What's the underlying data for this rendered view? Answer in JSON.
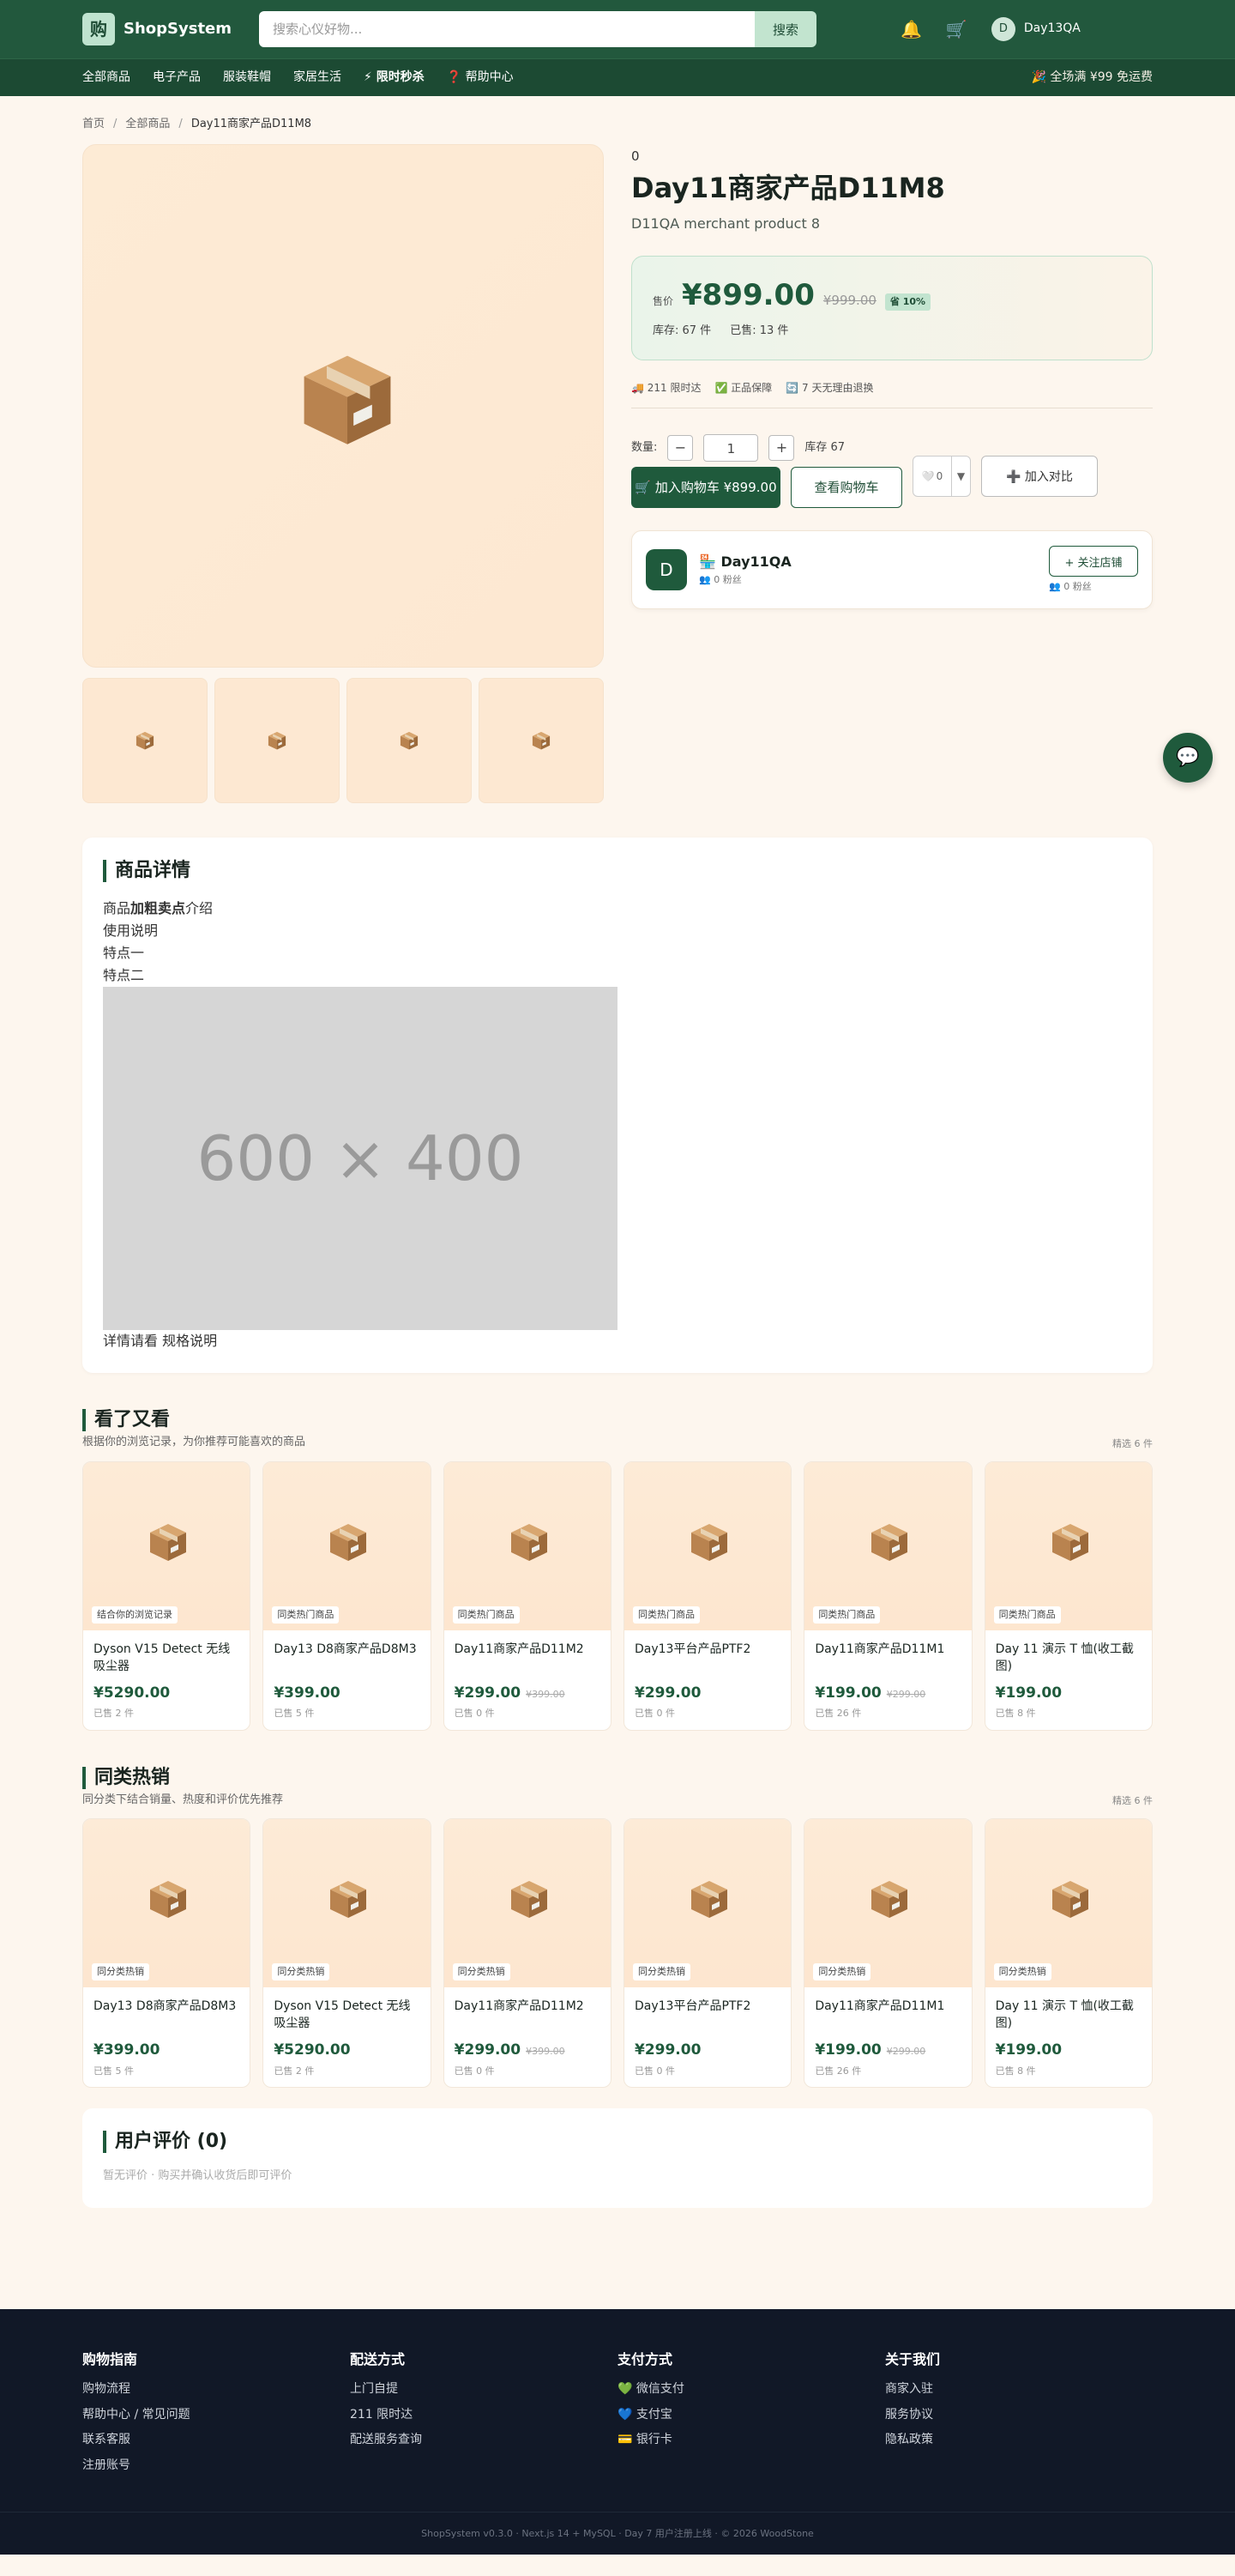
{
  "header": {
    "logo_char": "购",
    "logo_text": "ShopSystem",
    "search_placeholder": "搜索心仪好物...",
    "search_button": "搜索",
    "user_initial": "D",
    "user_name": "Day13QA"
  },
  "nav": {
    "items": [
      "全部商品",
      "电子产品",
      "服装鞋帽",
      "家居生活",
      "⚡ 限时秒杀",
      "❓ 帮助中心"
    ],
    "promo": "🎉 全场满 ¥99 免运费"
  },
  "breadcrumb": [
    "首页",
    "全部商品",
    "Day11商家产品D11M8"
  ],
  "product": {
    "keyword": "0",
    "title": "Day11商家产品D11M8",
    "subtitle": "D11QA merchant product 8",
    "price_label": "售价",
    "price": "¥899.00",
    "old_price": "¥999.00",
    "discount": "省 10%",
    "stock": "库存: 67 件",
    "sold": "已售: 13 件",
    "tags": [
      "🚚 211 限时达",
      "✅ 正品保障",
      "🔄 7 天无理由退换"
    ],
    "qty_label": "数量:",
    "qty_minus": "−",
    "qty_value": "1",
    "qty_plus": "+",
    "qty_stock": "库存 67",
    "add_cart": "🛒 加入购物车 ¥899.00",
    "view_cart": "查看购物车",
    "fav_count": "0",
    "compare": "➕ 加入对比"
  },
  "shop": {
    "initial": "D",
    "name": "🏪 Day11QA",
    "fans": "👥 0 粉丝",
    "follow": "+ 关注店铺",
    "fans2": "👥 0 粉丝"
  },
  "detail": {
    "title": "商品详情",
    "line1_pre": "商品",
    "line1_bold": "加粗卖点",
    "line1_post": "介绍",
    "line2": "使用说明",
    "line3": "特点一",
    "line4": "特点二",
    "placeholder": "600 × 400",
    "footer": "详情请看 规格说明"
  },
  "rec1": {
    "title": "看了又看",
    "sub": "根据你的浏览记录，为你推荐可能喜欢的商品",
    "count": "精选 6 件",
    "items": [
      {
        "badge": "结合你的浏览记录",
        "name": "Dyson V15 Detect 无线吸尘器",
        "price": "¥5290.00",
        "old": "",
        "sold": "已售 2 件"
      },
      {
        "badge": "同类热门商品",
        "name": "Day13 D8商家产品D8M3",
        "price": "¥399.00",
        "old": "",
        "sold": "已售 5 件"
      },
      {
        "badge": "同类热门商品",
        "name": "Day11商家产品D11M2",
        "price": "¥299.00",
        "old": "¥399.00",
        "sold": "已售 0 件"
      },
      {
        "badge": "同类热门商品",
        "name": "Day13平台产品PTF2",
        "price": "¥299.00",
        "old": "",
        "sold": "已售 0 件"
      },
      {
        "badge": "同类热门商品",
        "name": "Day11商家产品D11M1",
        "price": "¥199.00",
        "old": "¥299.00",
        "sold": "已售 26 件"
      },
      {
        "badge": "同类热门商品",
        "name": "Day 11 演示 T 恤(收工截图)",
        "price": "¥199.00",
        "old": "",
        "sold": "已售 8 件"
      }
    ]
  },
  "rec2": {
    "title": "同类热销",
    "sub": "同分类下结合销量、热度和评价优先推荐",
    "count": "精选 6 件",
    "items": [
      {
        "badge": "同分类热销",
        "name": "Day13 D8商家产品D8M3",
        "price": "¥399.00",
        "old": "",
        "sold": "已售 5 件"
      },
      {
        "badge": "同分类热销",
        "name": "Dyson V15 Detect 无线吸尘器",
        "price": "¥5290.00",
        "old": "",
        "sold": "已售 2 件"
      },
      {
        "badge": "同分类热销",
        "name": "Day11商家产品D11M2",
        "price": "¥299.00",
        "old": "¥399.00",
        "sold": "已售 0 件"
      },
      {
        "badge": "同分类热销",
        "name": "Day13平台产品PTF2",
        "price": "¥299.00",
        "old": "",
        "sold": "已售 0 件"
      },
      {
        "badge": "同分类热销",
        "name": "Day11商家产品D11M1",
        "price": "¥199.00",
        "old": "¥299.00",
        "sold": "已售 26 件"
      },
      {
        "badge": "同分类热销",
        "name": "Day 11 演示 T 恤(收工截图)",
        "price": "¥199.00",
        "old": "",
        "sold": "已售 8 件"
      }
    ]
  },
  "reviews": {
    "title": "用户评价 (0)",
    "empty": "暂无评价 · 购买并确认收货后即可评价"
  },
  "footer": {
    "cols": [
      {
        "title": "购物指南",
        "links": [
          "购物流程",
          "帮助中心 / 常见问题",
          "联系客服",
          "注册账号"
        ]
      },
      {
        "title": "配送方式",
        "links": [
          "上门自提",
          "211 限时达",
          "配送服务查询"
        ]
      },
      {
        "title": "支付方式",
        "links": [
          "💚 微信支付",
          "💙 支付宝",
          "💳 银行卡"
        ]
      },
      {
        "title": "关于我们",
        "links": [
          "商家入驻",
          "服务协议",
          "隐私政策"
        ]
      }
    ],
    "copyright": "ShopSystem v0.3.0 · Next.js 14 + MySQL · Day 7 用户注册上线 · © 2026 WoodStone"
  },
  "colors": {
    "brand": "#22583d",
    "price": "#1f5a3c",
    "bg": "#fdf6ee"
  }
}
